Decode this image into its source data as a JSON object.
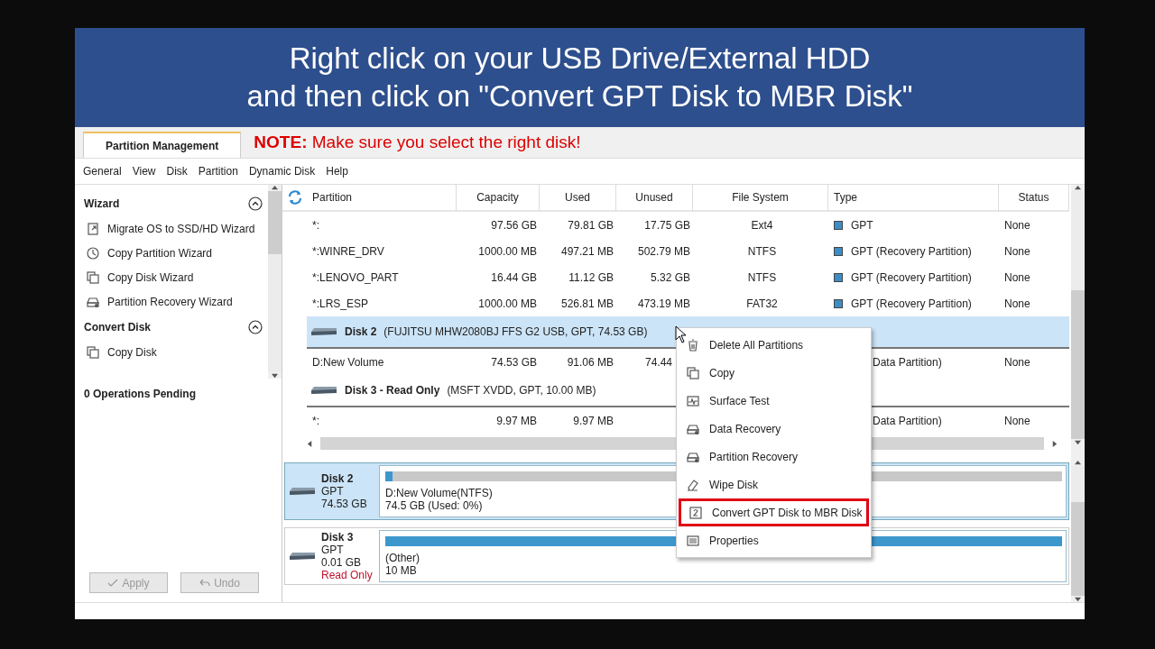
{
  "banner": {
    "lines": [
      "Right click on your USB Drive/External HDD",
      "and then click on \"Convert GPT Disk to MBR Disk\""
    ]
  },
  "tab": {
    "label": "Partition Management",
    "selected": true
  },
  "note": "**NOTE:** Make sure you select the right disk!",
  "menu": [
    "General",
    "View",
    "Disk",
    "Partition",
    "Dynamic Disk",
    "Help"
  ],
  "sidebar": {
    "sections": [
      {
        "title": "Wizard",
        "expanded": true,
        "items": [
          {
            "label": "Migrate OS to SSD/HD Wizard",
            "kind": "migrate"
          },
          {
            "label": "Copy Partition Wizard",
            "kind": "clock"
          },
          {
            "label": "Copy Disk Wizard",
            "kind": "copy"
          },
          {
            "label": "Partition Recovery Wizard",
            "kind": "drive"
          }
        ]
      },
      {
        "title": "Convert Disk",
        "expanded": true,
        "items": [
          {
            "label": "Copy Disk",
            "kind": "copy"
          }
        ]
      }
    ],
    "operations": "0 Operations Pending",
    "buttons": [
      {
        "label": "Apply",
        "kind": "apply",
        "disabled": true
      },
      {
        "label": "Undo",
        "kind": "undo",
        "disabled": true
      }
    ]
  },
  "table": {
    "columns": [
      "Partition",
      "Capacity",
      "Used",
      "Unused",
      "File System",
      "Type",
      "Status"
    ],
    "rows": [
      {
        "kind": "partition",
        "cells": {
          "partition": "*:",
          "capacity": "97.56 GB",
          "used": "79.81 GB",
          "unused": "17.75 GB",
          "file_system": "Ext4",
          "type": "GPT",
          "status": "None"
        }
      },
      {
        "kind": "partition",
        "cells": {
          "partition": "*:WINRE_DRV",
          "capacity": "1000.00 MB",
          "used": "497.21 MB",
          "unused": "502.79 MB",
          "file_system": "NTFS",
          "type": "GPT (Recovery Partition)",
          "status": "None"
        }
      },
      {
        "kind": "partition",
        "cells": {
          "partition": "*:LENOVO_PART",
          "capacity": "16.44 GB",
          "used": "11.12 GB",
          "unused": "5.32 GB",
          "file_system": "NTFS",
          "type": "GPT (Recovery Partition)",
          "status": "None"
        }
      },
      {
        "kind": "partition",
        "cells": {
          "partition": "*:LRS_ESP",
          "capacity": "1000.00 MB",
          "used": "526.81 MB",
          "unused": "473.19 MB",
          "file_system": "FAT32",
          "type": "GPT (Recovery Partition)",
          "status": "None"
        }
      },
      {
        "kind": "disk",
        "selected": true,
        "title": "Disk 2",
        "detail": "(FUJITSU MHW2080BJ FFS G2 USB, GPT, 74.53 GB)"
      },
      {
        "kind": "partition",
        "cells": {
          "partition": "D:New Volume",
          "capacity": "74.53 GB",
          "used": "91.06 MB",
          "unused": "74.44",
          "type": "Data Partition)",
          "status": "None"
        },
        "partly_covered": true
      },
      {
        "kind": "disk",
        "selected": false,
        "title": "Disk 3 - Read Only",
        "detail": "(MSFT XVDD, GPT, 10.00 MB)"
      },
      {
        "kind": "partition",
        "cells": {
          "partition": "*:",
          "capacity": "9.97 MB",
          "used": "9.97 MB",
          "type": "Data Partition)",
          "status": "None"
        },
        "partly_covered": true
      }
    ]
  },
  "disk_map": [
    {
      "name": "Disk 2",
      "scheme": "GPT",
      "size": "74.53 GB",
      "selected": true,
      "partition": {
        "label": "D:New Volume(NTFS)",
        "size": "74.5 GB (Used: 0%)",
        "level": 0.01
      }
    },
    {
      "name": "Disk 3",
      "scheme": "GPT",
      "size": "0.01 GB",
      "status": "Read Only",
      "selected": false,
      "partition": {
        "label": "(Other)",
        "size": "10 MB",
        "level": 1
      }
    }
  ],
  "context_menu": [
    {
      "label": "Delete All Partitions",
      "kind": "trash",
      "highlighted": false
    },
    {
      "label": "Copy",
      "kind": "copy",
      "highlighted": false
    },
    {
      "label": "Surface Test",
      "kind": "test",
      "highlighted": false
    },
    {
      "label": "Data Recovery",
      "kind": "drive",
      "highlighted": false
    },
    {
      "label": "Partition Recovery",
      "kind": "drive",
      "highlighted": false
    },
    {
      "label": "Wipe Disk",
      "kind": "eraser",
      "highlighted": false
    },
    {
      "label": "Convert GPT Disk to MBR Disk",
      "kind": "convert",
      "highlighted": true
    },
    {
      "label": "Properties",
      "kind": "list",
      "highlighted": false
    }
  ]
}
